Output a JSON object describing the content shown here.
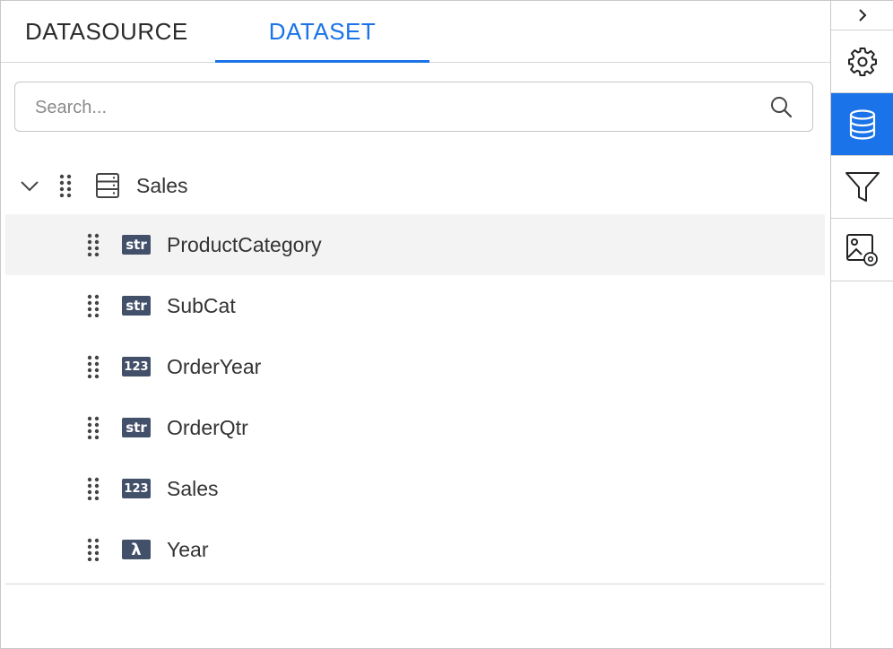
{
  "tabs": [
    {
      "label": "DATASOURCE",
      "active": false
    },
    {
      "label": "DATASET",
      "active": true
    }
  ],
  "search": {
    "placeholder": "Search...",
    "value": ""
  },
  "tree": {
    "root": {
      "label": "Sales",
      "expanded": true,
      "icon": "table-icon"
    },
    "fields": [
      {
        "label": "ProductCategory",
        "type": "str",
        "selected": true
      },
      {
        "label": "SubCat",
        "type": "str"
      },
      {
        "label": "OrderYear",
        "type": "123"
      },
      {
        "label": "OrderQtr",
        "type": "str"
      },
      {
        "label": "Sales",
        "type": "123"
      },
      {
        "label": "Year",
        "type": "λ"
      }
    ]
  },
  "toolbar": {
    "items": [
      {
        "icon": "chevron-right-icon"
      },
      {
        "icon": "gear-icon"
      },
      {
        "icon": "database-icon",
        "active": true
      },
      {
        "icon": "filter-icon"
      },
      {
        "icon": "image-settings-icon"
      }
    ]
  },
  "colors": {
    "accent": "#1a73e8",
    "badge": "#43506a",
    "selected_row": "#f3f3f3"
  }
}
